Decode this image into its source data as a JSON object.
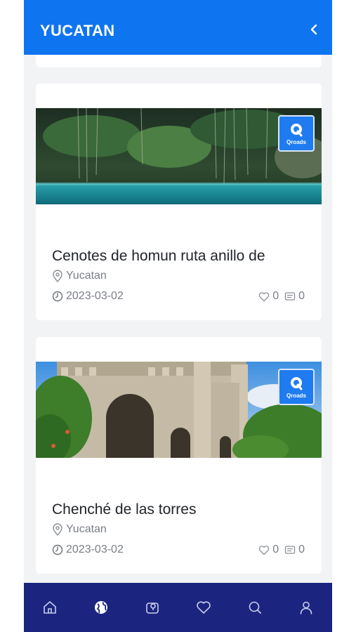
{
  "header": {
    "title": "YUCATAN",
    "back_icon": "chevron-left-icon"
  },
  "cards": [
    {
      "name": "Cenotes de homun ruta anillo de",
      "location": "Yucatan",
      "date": "2023-03-02",
      "likes": "0",
      "comments": "0",
      "badge": "Qroads"
    },
    {
      "name": "Chenché de las torres",
      "location": "Yucatan",
      "date": "2023-03-02",
      "likes": "0",
      "comments": "0",
      "badge": "Qroads"
    }
  ],
  "tabbar": {
    "items": [
      "home-icon",
      "globe-icon",
      "map-pin-square-icon",
      "heart-icon",
      "search-icon",
      "user-icon"
    ],
    "active_index": 1
  },
  "colors": {
    "header": "#0f74f0",
    "tabbar": "#1b2580",
    "badge": "#1e7bf0"
  }
}
